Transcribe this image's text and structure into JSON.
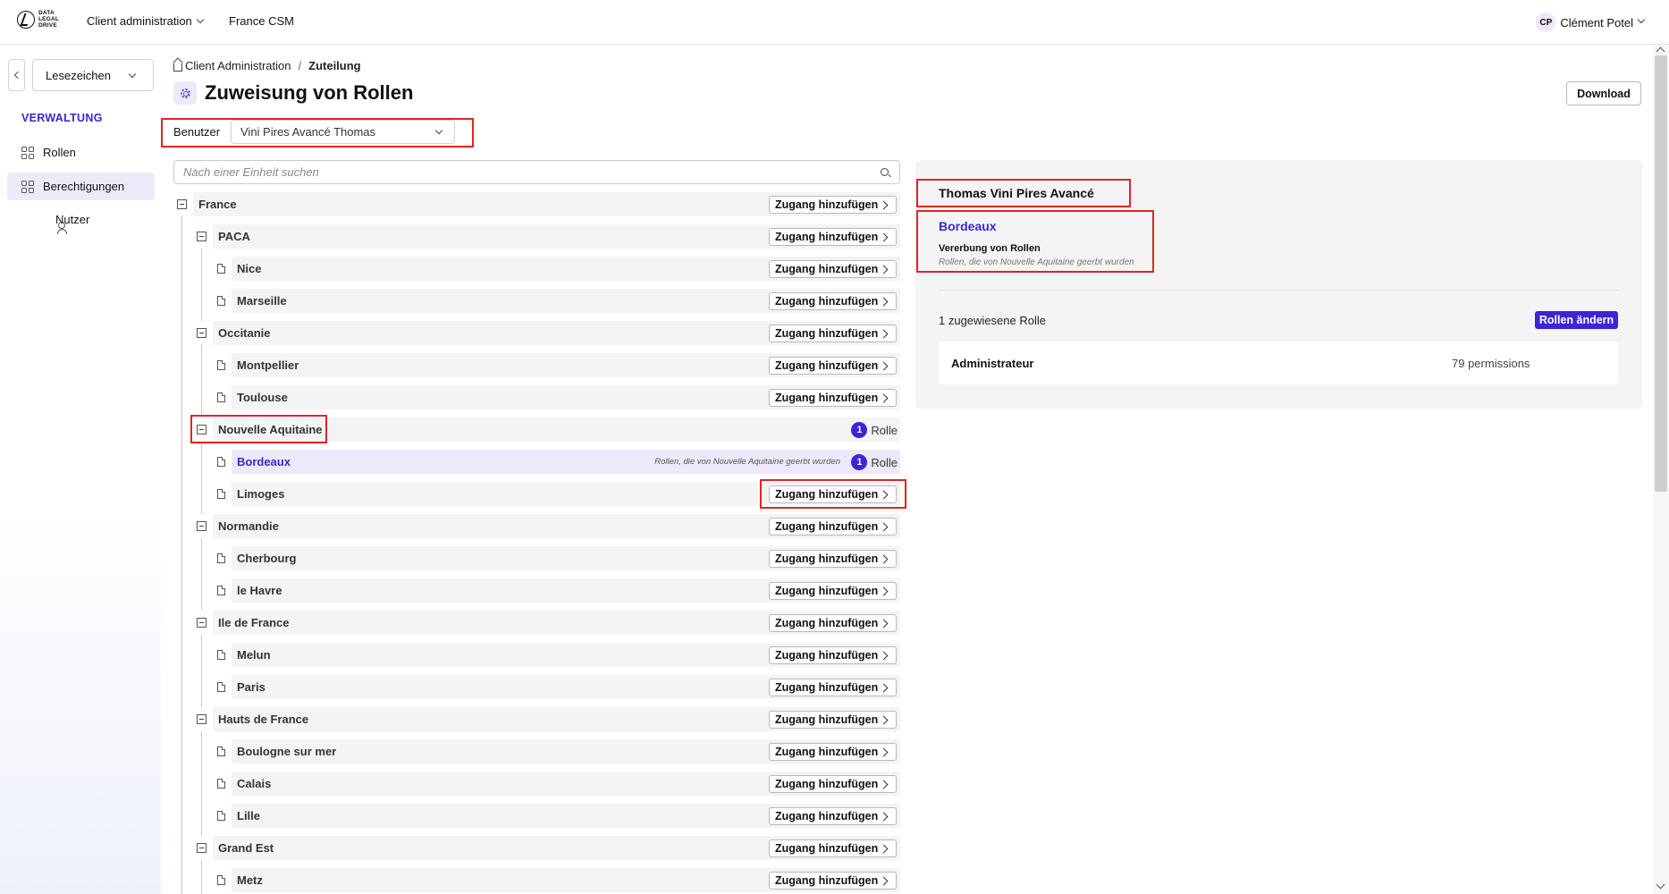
{
  "header": {
    "logo_text": [
      "DATA",
      "LEGAL",
      "DRIVE"
    ],
    "nav": [
      "Client administration",
      "France CSM"
    ],
    "user_initials": "CP",
    "user_name": "Clément Potel"
  },
  "sidebar": {
    "bookmark_label": "Lesezeichen",
    "section": "VERWALTUNG",
    "items": [
      {
        "label": "Rollen",
        "icon": "grid-icon"
      },
      {
        "label": "Berechtigungen",
        "icon": "grid-icon",
        "active": true
      },
      {
        "label": "Nutzer",
        "icon": "users-icon"
      }
    ]
  },
  "breadcrumb": [
    "Client Administration",
    "/",
    "Zuteilung"
  ],
  "page": {
    "title": "Zuweisung von Rollen",
    "download_label": "Download",
    "user_label": "Benutzer",
    "user_value": "Vini Pires Avancé Thomas",
    "search_placeholder": "Nach einer Einheit suchen"
  },
  "tree": {
    "add_label": "Zugang hinzufügen",
    "role_count": "1",
    "role_label": "Rolle",
    "inherit_note": "Rollen, die von Nouvelle Aquitaine geerbt wurden",
    "rows": [
      {
        "label": "France",
        "level": 0
      },
      {
        "label": "PACA",
        "level": 1
      },
      {
        "label": "Nice",
        "level": 2
      },
      {
        "label": "Marseille",
        "level": 2
      },
      {
        "label": "Occitanie",
        "level": 1
      },
      {
        "label": "Montpellier",
        "level": 2
      },
      {
        "label": "Toulouse",
        "level": 2
      },
      {
        "label": "Nouvelle Aquitaine",
        "level": 1,
        "roles": true
      },
      {
        "label": "Bordeaux",
        "level": 2,
        "roles": true,
        "inherited": true,
        "selected": true
      },
      {
        "label": "Limoges",
        "level": 2
      },
      {
        "label": "Normandie",
        "level": 1
      },
      {
        "label": "Cherbourg",
        "level": 2
      },
      {
        "label": "le Havre",
        "level": 2
      },
      {
        "label": "Ile de France",
        "level": 1
      },
      {
        "label": "Melun",
        "level": 2
      },
      {
        "label": "Paris",
        "level": 2
      },
      {
        "label": "Hauts de France",
        "level": 1
      },
      {
        "label": "Boulogne sur mer",
        "level": 2
      },
      {
        "label": "Calais",
        "level": 2
      },
      {
        "label": "Lille",
        "level": 2
      },
      {
        "label": "Grand Est",
        "level": 1
      },
      {
        "label": "Metz",
        "level": 2
      }
    ]
  },
  "panel": {
    "user": "Thomas Vini Pires Avancé",
    "unit": "Bordeaux",
    "inherit_title": "Vererbung von Rollen",
    "inherit_note": "Rollen, die von Nouvelle Aquitaine geerbt wurden",
    "count_text": "1 zugewiesene Rolle",
    "change_label": "Rollen ändern",
    "role_name": "Administrateur",
    "role_permissions": "79 permissions"
  },
  "colors": {
    "accent": "#3b25d6",
    "highlight": "#e32424"
  }
}
